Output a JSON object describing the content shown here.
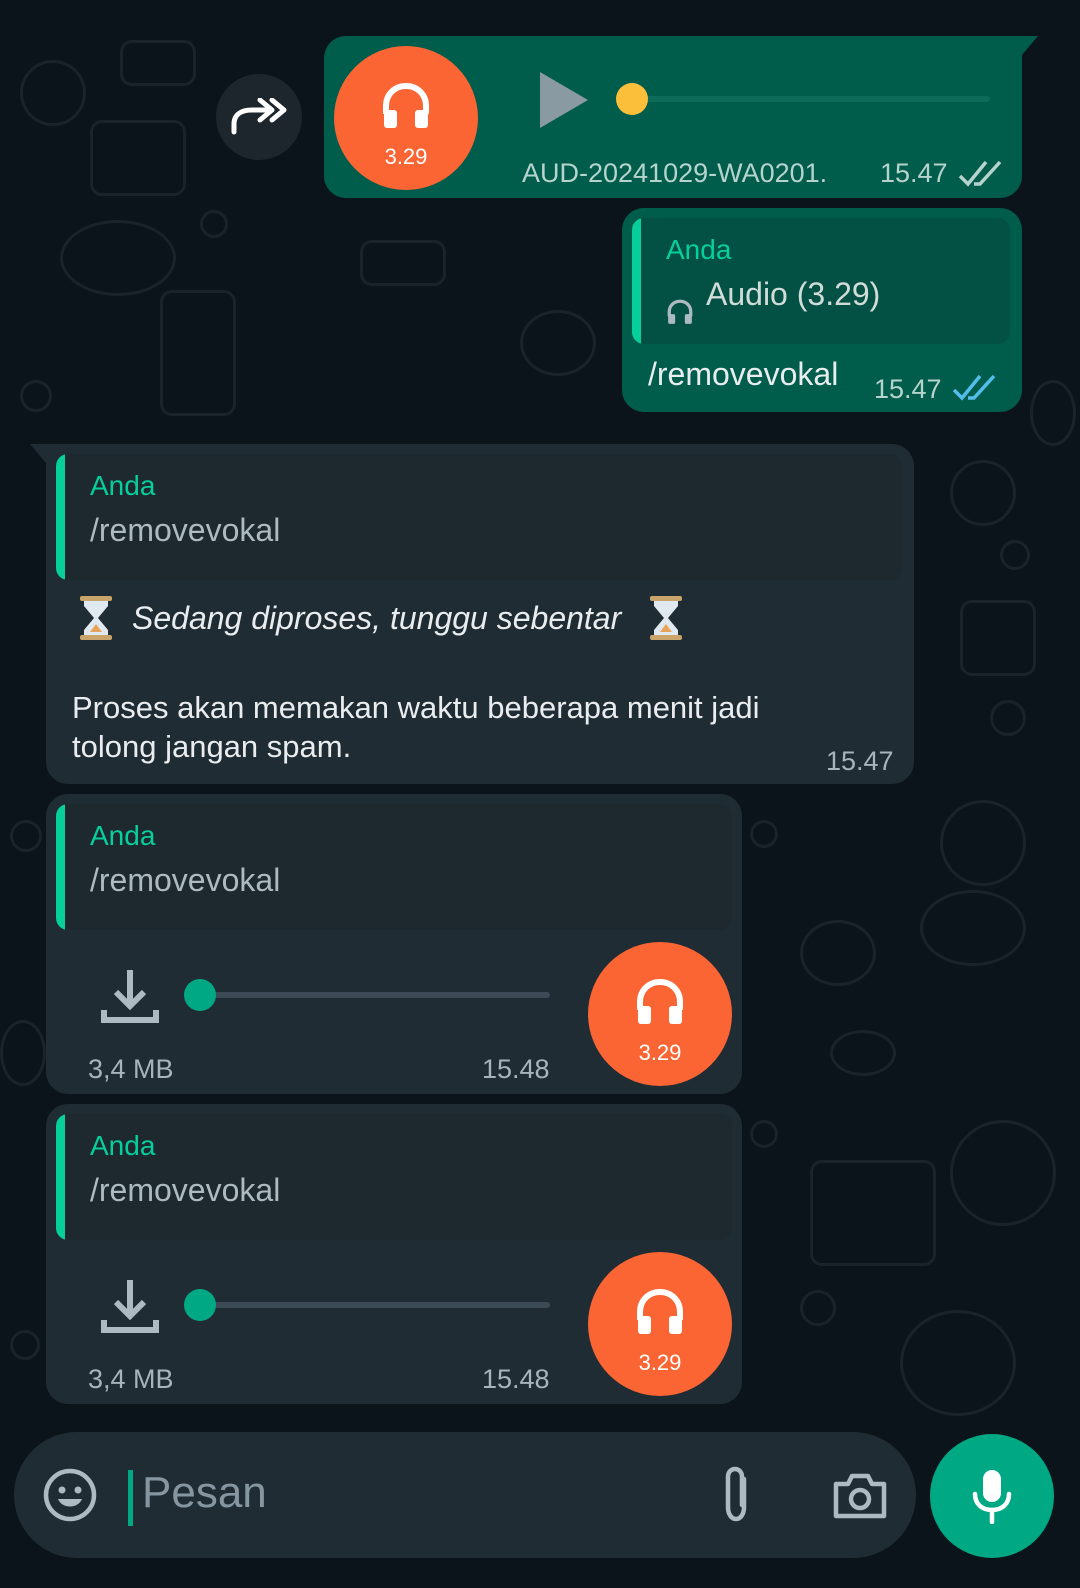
{
  "colors": {
    "background": "#0b141a",
    "outgoing_bubble": "#005c4b",
    "incoming_bubble": "#202c33",
    "accent": "#06cf9c",
    "audio_avatar": "#fa6533",
    "read_ticks": "#53bdeb",
    "sent_ticks": "#b6d4cd"
  },
  "messages": [
    {
      "type": "forwarded-audio",
      "direction": "outgoing",
      "duration": "3.29",
      "filename": "AUD-20241029-WA0201.",
      "time": "15.47",
      "status": "read",
      "icons": [
        "forward-icon",
        "headphones-icon",
        "play-icon",
        "double-check-icon"
      ]
    },
    {
      "type": "reply-text",
      "direction": "outgoing",
      "quote_author": "Anda",
      "quote_text": "Audio (3.29)",
      "text": "/removevokal",
      "time": "15.47",
      "status": "read"
    },
    {
      "type": "reply-text",
      "direction": "incoming",
      "quote_author": "Anda",
      "quote_text": "/removevokal",
      "status_line": "Sedang diproses, tunggu sebentar",
      "body_line1": "Proses akan memakan waktu beberapa menit jadi",
      "body_line2": "tolong jangan spam.",
      "time": "15.47",
      "icons": [
        "hourglass-icon"
      ]
    },
    {
      "type": "reply-audio",
      "direction": "incoming",
      "quote_author": "Anda",
      "quote_text": "/removevokal",
      "size": "3,4 MB",
      "duration": "3.29",
      "time": "15.48",
      "icons": [
        "download-icon",
        "headphones-icon"
      ]
    },
    {
      "type": "reply-audio",
      "direction": "incoming",
      "quote_author": "Anda",
      "quote_text": "/removevokal",
      "size": "3,4 MB",
      "duration": "3.29",
      "time": "15.48",
      "icons": [
        "download-icon",
        "headphones-icon"
      ]
    }
  ],
  "input": {
    "placeholder": "Pesan",
    "icons": [
      "emoji-icon",
      "attach-icon",
      "camera-icon",
      "mic-icon"
    ]
  }
}
